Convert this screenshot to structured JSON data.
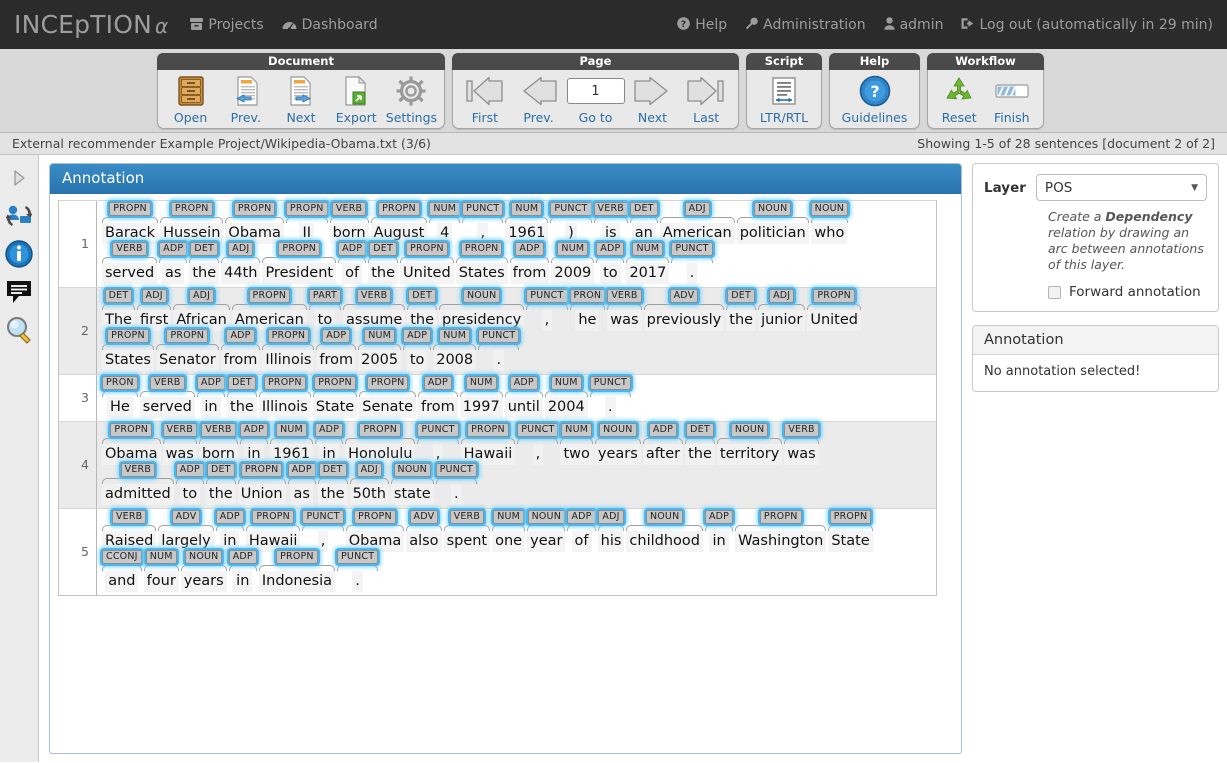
{
  "topnav": {
    "brand": "INCEpTION",
    "brand_alpha": "α",
    "left_links": [
      {
        "label": "Projects",
        "icon": "archive-icon"
      },
      {
        "label": "Dashboard",
        "icon": "dashboard-icon"
      }
    ],
    "right_links": [
      {
        "label": "Help",
        "icon": "question-circle-icon"
      },
      {
        "label": "Administration",
        "icon": "wrench-icon"
      },
      {
        "label": "admin",
        "icon": "user-icon"
      },
      {
        "label": "Log out (automatically in 29 min)",
        "icon": "logout-icon"
      }
    ]
  },
  "ribbon": {
    "groups": [
      {
        "title": "Document",
        "buttons": [
          {
            "label": "Open",
            "icon": "cabinet-icon"
          },
          {
            "label": "Prev.",
            "icon": "document-left-arrow-icon"
          },
          {
            "label": "Next",
            "icon": "document-right-arrow-icon"
          },
          {
            "label": "Export",
            "icon": "document-export-icon"
          },
          {
            "label": "Settings",
            "icon": "gear-icon"
          }
        ]
      },
      {
        "title": "Page",
        "buttons": [
          {
            "label": "First",
            "icon": "arrow-first-icon"
          },
          {
            "label": "Prev.",
            "icon": "arrow-left-icon"
          },
          {
            "label": "Go to",
            "icon": "page-number-input"
          },
          {
            "label": "Next",
            "icon": "arrow-right-icon"
          },
          {
            "label": "Last",
            "icon": "arrow-last-icon"
          }
        ],
        "page_value": "1"
      },
      {
        "title": "Script",
        "buttons": [
          {
            "label": "LTR/RTL",
            "icon": "text-direction-icon"
          }
        ]
      },
      {
        "title": "Help",
        "buttons": [
          {
            "label": "Guidelines",
            "icon": "question-circle-blue-icon"
          }
        ]
      },
      {
        "title": "Workflow",
        "buttons": [
          {
            "label": "Reset",
            "icon": "recycle-icon"
          },
          {
            "label": "Finish",
            "icon": "progress-bar-icon"
          }
        ]
      }
    ]
  },
  "statusbar": {
    "left": "External recommender Example Project/Wikipedia-Obama.txt (3/6)",
    "right": "Showing 1-5 of 28 sentences [document 2 of 2]"
  },
  "leftrail": {
    "items": [
      {
        "name": "expand-arrow-icon"
      },
      {
        "name": "user-sync-icon"
      },
      {
        "name": "info-icon"
      },
      {
        "name": "comment-icon"
      },
      {
        "name": "search-icon"
      }
    ]
  },
  "annotation_panel": {
    "title": "Annotation",
    "sentences": [
      {
        "number": "1",
        "lines": [
          [
            {
              "tag": "PROPN",
              "word": "Barack"
            },
            {
              "tag": "PROPN",
              "word": "Hussein"
            },
            {
              "tag": "PROPN",
              "word": "Obama"
            },
            {
              "tag": "PROPN",
              "word": "II"
            },
            {
              "tag": "VERB",
              "word": "born"
            },
            {
              "tag": "PROPN",
              "word": "August"
            },
            {
              "tag": "NUM",
              "word": "4"
            },
            {
              "tag": "PUNCT",
              "word": ","
            },
            {
              "tag": "NUM",
              "word": "1961"
            },
            {
              "tag": "PUNCT",
              "word": ")"
            },
            {
              "tag": "VERB",
              "word": "is"
            },
            {
              "tag": "DET",
              "word": "an"
            },
            {
              "tag": "ADJ",
              "word": "American"
            },
            {
              "tag": "NOUN",
              "word": "politician"
            },
            {
              "tag": "NOUN",
              "word": "who"
            }
          ],
          [
            {
              "tag": "VERB",
              "word": "served"
            },
            {
              "tag": "ADP",
              "word": "as"
            },
            {
              "tag": "DET",
              "word": "the"
            },
            {
              "tag": "ADJ",
              "word": "44th"
            },
            {
              "tag": "PROPN",
              "word": "President"
            },
            {
              "tag": "ADP",
              "word": "of"
            },
            {
              "tag": "DET",
              "word": "the"
            },
            {
              "tag": "PROPN",
              "word": "United"
            },
            {
              "tag": "PROPN",
              "word": "States"
            },
            {
              "tag": "ADP",
              "word": "from"
            },
            {
              "tag": "NUM",
              "word": "2009"
            },
            {
              "tag": "ADP",
              "word": "to"
            },
            {
              "tag": "NUM",
              "word": "2017"
            },
            {
              "tag": "PUNCT",
              "word": "."
            }
          ]
        ]
      },
      {
        "number": "2",
        "lines": [
          [
            {
              "tag": "DET",
              "word": "The"
            },
            {
              "tag": "ADJ",
              "word": "first"
            },
            {
              "tag": "ADJ",
              "word": "African"
            },
            {
              "tag": "PROPN",
              "word": "American"
            },
            {
              "tag": "PART",
              "word": "to"
            },
            {
              "tag": "VERB",
              "word": "assume"
            },
            {
              "tag": "DET",
              "word": "the"
            },
            {
              "tag": "NOUN",
              "word": "presidency"
            },
            {
              "tag": "PUNCT",
              "word": ","
            },
            {
              "tag": "PRON",
              "word": "he"
            },
            {
              "tag": "VERB",
              "word": "was"
            },
            {
              "tag": "ADV",
              "word": "previously"
            },
            {
              "tag": "DET",
              "word": "the"
            },
            {
              "tag": "ADJ",
              "word": "junior"
            },
            {
              "tag": "PROPN",
              "word": "United"
            }
          ],
          [
            {
              "tag": "PROPN",
              "word": "States"
            },
            {
              "tag": "PROPN",
              "word": "Senator"
            },
            {
              "tag": "ADP",
              "word": "from"
            },
            {
              "tag": "PROPN",
              "word": "Illinois"
            },
            {
              "tag": "ADP",
              "word": "from"
            },
            {
              "tag": "NUM",
              "word": "2005"
            },
            {
              "tag": "ADP",
              "word": "to"
            },
            {
              "tag": "NUM",
              "word": "2008"
            },
            {
              "tag": "PUNCT",
              "word": "."
            }
          ]
        ]
      },
      {
        "number": "3",
        "lines": [
          [
            {
              "tag": "PRON",
              "word": "He"
            },
            {
              "tag": "VERB",
              "word": "served"
            },
            {
              "tag": "ADP",
              "word": "in"
            },
            {
              "tag": "DET",
              "word": "the"
            },
            {
              "tag": "PROPN",
              "word": "Illinois"
            },
            {
              "tag": "PROPN",
              "word": "State"
            },
            {
              "tag": "PROPN",
              "word": "Senate"
            },
            {
              "tag": "ADP",
              "word": "from"
            },
            {
              "tag": "NUM",
              "word": "1997"
            },
            {
              "tag": "ADP",
              "word": "until"
            },
            {
              "tag": "NUM",
              "word": "2004"
            },
            {
              "tag": "PUNCT",
              "word": "."
            }
          ]
        ]
      },
      {
        "number": "4",
        "lines": [
          [
            {
              "tag": "PROPN",
              "word": "Obama"
            },
            {
              "tag": "VERB",
              "word": "was"
            },
            {
              "tag": "VERB",
              "word": "born"
            },
            {
              "tag": "ADP",
              "word": "in"
            },
            {
              "tag": "NUM",
              "word": "1961"
            },
            {
              "tag": "ADP",
              "word": "in"
            },
            {
              "tag": "PROPN",
              "word": "Honolulu"
            },
            {
              "tag": "PUNCT",
              "word": ","
            },
            {
              "tag": "PROPN",
              "word": "Hawaii"
            },
            {
              "tag": "PUNCT",
              "word": ","
            },
            {
              "tag": "NUM",
              "word": "two"
            },
            {
              "tag": "NOUN",
              "word": "years"
            },
            {
              "tag": "ADP",
              "word": "after"
            },
            {
              "tag": "DET",
              "word": "the"
            },
            {
              "tag": "NOUN",
              "word": "territory"
            },
            {
              "tag": "VERB",
              "word": "was"
            }
          ],
          [
            {
              "tag": "VERB",
              "word": "admitted"
            },
            {
              "tag": "ADP",
              "word": "to"
            },
            {
              "tag": "DET",
              "word": "the"
            },
            {
              "tag": "PROPN",
              "word": "Union"
            },
            {
              "tag": "ADP",
              "word": "as"
            },
            {
              "tag": "DET",
              "word": "the"
            },
            {
              "tag": "ADJ",
              "word": "50th"
            },
            {
              "tag": "NOUN",
              "word": "state"
            },
            {
              "tag": "PUNCT",
              "word": "."
            }
          ]
        ]
      },
      {
        "number": "5",
        "lines": [
          [
            {
              "tag": "VERB",
              "word": "Raised"
            },
            {
              "tag": "ADV",
              "word": "largely"
            },
            {
              "tag": "ADP",
              "word": "in"
            },
            {
              "tag": "PROPN",
              "word": "Hawaii"
            },
            {
              "tag": "PUNCT",
              "word": ","
            },
            {
              "tag": "PROPN",
              "word": "Obama"
            },
            {
              "tag": "ADV",
              "word": "also"
            },
            {
              "tag": "VERB",
              "word": "spent"
            },
            {
              "tag": "NUM",
              "word": "one"
            },
            {
              "tag": "NOUN",
              "word": "year"
            },
            {
              "tag": "ADP",
              "word": "of"
            },
            {
              "tag": "ADJ",
              "word": "his"
            },
            {
              "tag": "NOUN",
              "word": "childhood"
            },
            {
              "tag": "ADP",
              "word": "in"
            },
            {
              "tag": "PROPN",
              "word": "Washington"
            },
            {
              "tag": "PROPN",
              "word": "State"
            }
          ],
          [
            {
              "tag": "CCONJ",
              "word": "and"
            },
            {
              "tag": "NUM",
              "word": "four"
            },
            {
              "tag": "NOUN",
              "word": "years"
            },
            {
              "tag": "ADP",
              "word": "in"
            },
            {
              "tag": "PROPN",
              "word": "Indonesia"
            },
            {
              "tag": "PUNCT",
              "word": "."
            }
          ]
        ]
      }
    ]
  },
  "sidebar": {
    "layer": {
      "label": "Layer",
      "selected": "POS",
      "caret": "▼",
      "help_prefix": "Create a ",
      "help_bold": "Dependency",
      "help_suffix": " relation by drawing an arc between annotations of this layer.",
      "forward_label": "Forward annotation",
      "forward_checked": false
    },
    "annotation_card": {
      "title": "Annotation",
      "body": "No annotation selected!"
    }
  },
  "colors": {
    "nav_bg": "#2b2b2b",
    "ribbon_bg": "#d8d8d8",
    "panel_header": "#2c7cb8",
    "tag_glow": "#49b8f0",
    "link_blue": "#2b6ea5",
    "alt_row": "#ebebeb"
  }
}
